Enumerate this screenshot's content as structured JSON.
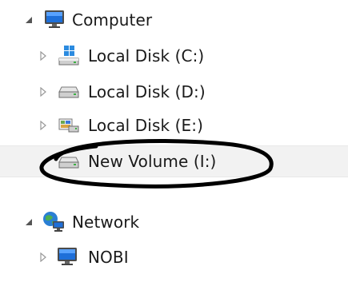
{
  "tree": {
    "computer": {
      "label": "Computer",
      "icon": "computer-icon",
      "expanded": true
    },
    "drives": [
      {
        "label": "Local Disk (C:)",
        "icon": "windows-drive-icon"
      },
      {
        "label": "Local Disk (D:)",
        "icon": "hard-drive-icon"
      },
      {
        "label": "Local Disk (E:)",
        "icon": "recovery-drive-icon"
      },
      {
        "label": "New Volume (I:)",
        "icon": "hard-drive-icon",
        "selected": true
      }
    ],
    "network": {
      "label": "Network",
      "icon": "network-icon",
      "expanded": true
    },
    "network_items": [
      {
        "label": "NOBI",
        "icon": "computer-icon"
      }
    ]
  },
  "colors": {
    "selection_bg": "#f2f2f2",
    "annotation_outline": "#000000",
    "monitor_blue": "#1e6fd9"
  }
}
